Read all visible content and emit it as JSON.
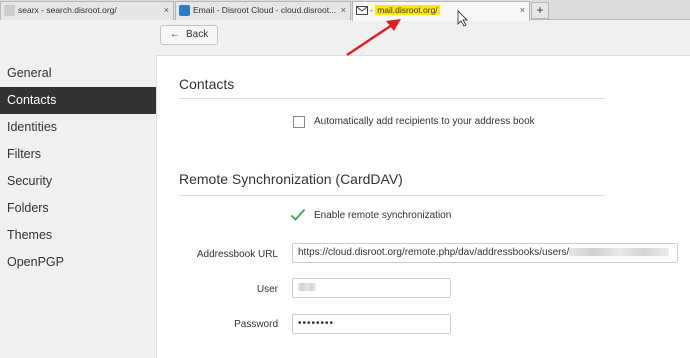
{
  "browser": {
    "tabs": [
      {
        "title": "searx - search.disroot.org/",
        "icon": "searx-favicon"
      },
      {
        "title": "Email - Disroot Cloud - cloud.disroot...",
        "icon": "cloud-favicon"
      },
      {
        "title_prefix": "- ",
        "title_highlight": "mail.disroot.org/",
        "icon": "mail-favicon"
      }
    ],
    "new_tab_label": "+",
    "close_glyph": "×",
    "highlight_color": "#ffe800",
    "annotation_color": "#e02020"
  },
  "toolbar": {
    "back_label": "Back"
  },
  "sidebar": {
    "items": [
      {
        "label": "General"
      },
      {
        "label": "Contacts"
      },
      {
        "label": "Identities"
      },
      {
        "label": "Filters"
      },
      {
        "label": "Security"
      },
      {
        "label": "Folders"
      },
      {
        "label": "Themes"
      },
      {
        "label": "OpenPGP"
      }
    ],
    "active_index": 1
  },
  "main": {
    "contacts_heading": "Contacts",
    "auto_add_label": "Automatically add recipients to your address book",
    "auto_add_checked": false,
    "remote_heading": "Remote Synchronization (CardDAV)",
    "enable_sync_label": "Enable remote synchronization",
    "enable_sync_checked": true,
    "addressbook_url_label": "Addressbook URL",
    "addressbook_url_value": "https://cloud.disroot.org/remote.php/dav/addressbooks/users/",
    "user_label": "User",
    "password_label": "Password",
    "password_value": "••••••••"
  },
  "colors": {
    "accent_check": "#3aa55a",
    "sidebar_active_bg": "#333333"
  }
}
